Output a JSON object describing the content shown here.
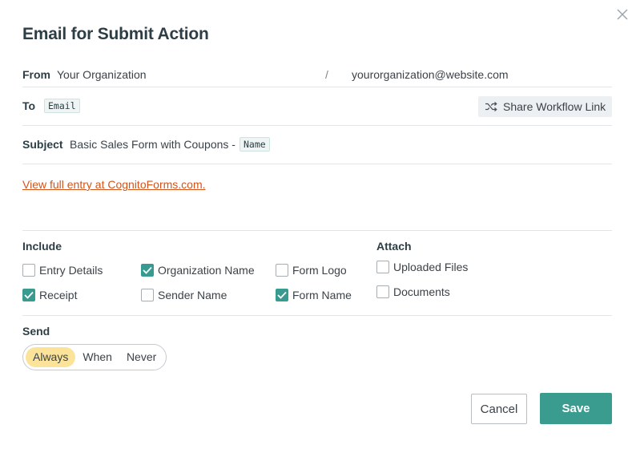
{
  "dialog": {
    "title": "Email for Submit Action",
    "close_icon": "close-icon"
  },
  "from": {
    "label": "From",
    "name": "Your Organization",
    "separator": "/",
    "email": "yourorganization@website.com"
  },
  "to": {
    "label": "To",
    "token": "Email",
    "share_button": "Share Workflow Link",
    "share_icon": "shuffle-icon"
  },
  "subject": {
    "label": "Subject",
    "text": "Basic Sales Form with Coupons -",
    "token": "Name"
  },
  "body": {
    "link": "View full entry at CognitoForms.com."
  },
  "include": {
    "label": "Include",
    "items": [
      {
        "label": "Entry Details",
        "checked": false
      },
      {
        "label": "Organization Name",
        "checked": true
      },
      {
        "label": "Form Logo",
        "checked": false
      },
      {
        "label": "Receipt",
        "checked": true
      },
      {
        "label": "Sender Name",
        "checked": false
      },
      {
        "label": "Form Name",
        "checked": true
      }
    ]
  },
  "attach": {
    "label": "Attach",
    "items": [
      {
        "label": "Uploaded Files",
        "checked": false
      },
      {
        "label": "Documents",
        "checked": false
      }
    ]
  },
  "send": {
    "label": "Send",
    "options": [
      "Always",
      "When",
      "Never"
    ],
    "selected": "Always"
  },
  "footer": {
    "cancel": "Cancel",
    "save": "Save"
  },
  "colors": {
    "accent": "#3a9b8f",
    "link": "#d3541a",
    "selected_option": "#fbe39a"
  }
}
